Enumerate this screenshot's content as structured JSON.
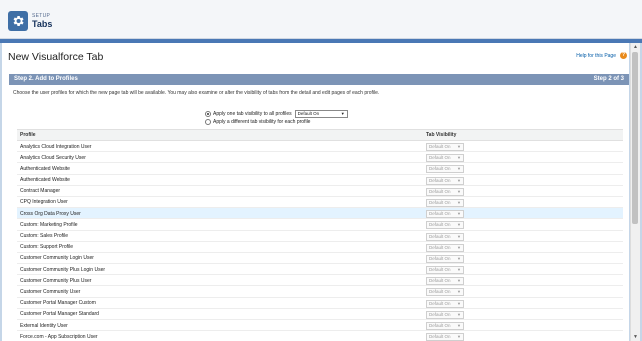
{
  "header": {
    "setup_label": "SETUP",
    "title": "Tabs",
    "icon": "gear-icon"
  },
  "page": {
    "title": "New Visualforce Tab",
    "help_link": "Help for this Page",
    "help_icon": "?"
  },
  "step": {
    "title": "Step 2. Add to Profiles",
    "count": "Step 2 of 3"
  },
  "instructions": "Choose the user profiles for which the new page tab will be available. You may also examine or alter the visibility of tabs from the detail and edit pages of each profile.",
  "options": {
    "apply_all_label": "Apply one tab visibility to all profiles",
    "apply_all_value": "Default On",
    "apply_each_label": "Apply a different tab visibility for each profile"
  },
  "table": {
    "col_profile": "Profile",
    "col_visibility": "Tab Visibility",
    "rows": [
      {
        "profile": "Analytics Cloud Integration User",
        "visibility": "Default On"
      },
      {
        "profile": "Analytics Cloud Security User",
        "visibility": "Default On"
      },
      {
        "profile": "Authenticated Website",
        "visibility": "Default On"
      },
      {
        "profile": "Authenticated Website",
        "visibility": "Default On"
      },
      {
        "profile": "Contract Manager",
        "visibility": "Default On"
      },
      {
        "profile": "CPQ Integration User",
        "visibility": "Default On"
      },
      {
        "profile": "Cross Org Data Proxy User",
        "visibility": "Default On"
      },
      {
        "profile": "Custom: Marketing Profile",
        "visibility": "Default On"
      },
      {
        "profile": "Custom: Sales Profile",
        "visibility": "Default On"
      },
      {
        "profile": "Custom: Support Profile",
        "visibility": "Default On"
      },
      {
        "profile": "Customer Community Login User",
        "visibility": "Default On"
      },
      {
        "profile": "Customer Community Plus Login User",
        "visibility": "Default On"
      },
      {
        "profile": "Customer Community Plus User",
        "visibility": "Default On"
      },
      {
        "profile": "Customer Community User",
        "visibility": "Default On"
      },
      {
        "profile": "Customer Portal Manager Custom",
        "visibility": "Default On"
      },
      {
        "profile": "Customer Portal Manager Standard",
        "visibility": "Default On"
      },
      {
        "profile": "External Identity User",
        "visibility": "Default On"
      },
      {
        "profile": "Force.com - App Subscription User",
        "visibility": "Default On"
      }
    ]
  }
}
